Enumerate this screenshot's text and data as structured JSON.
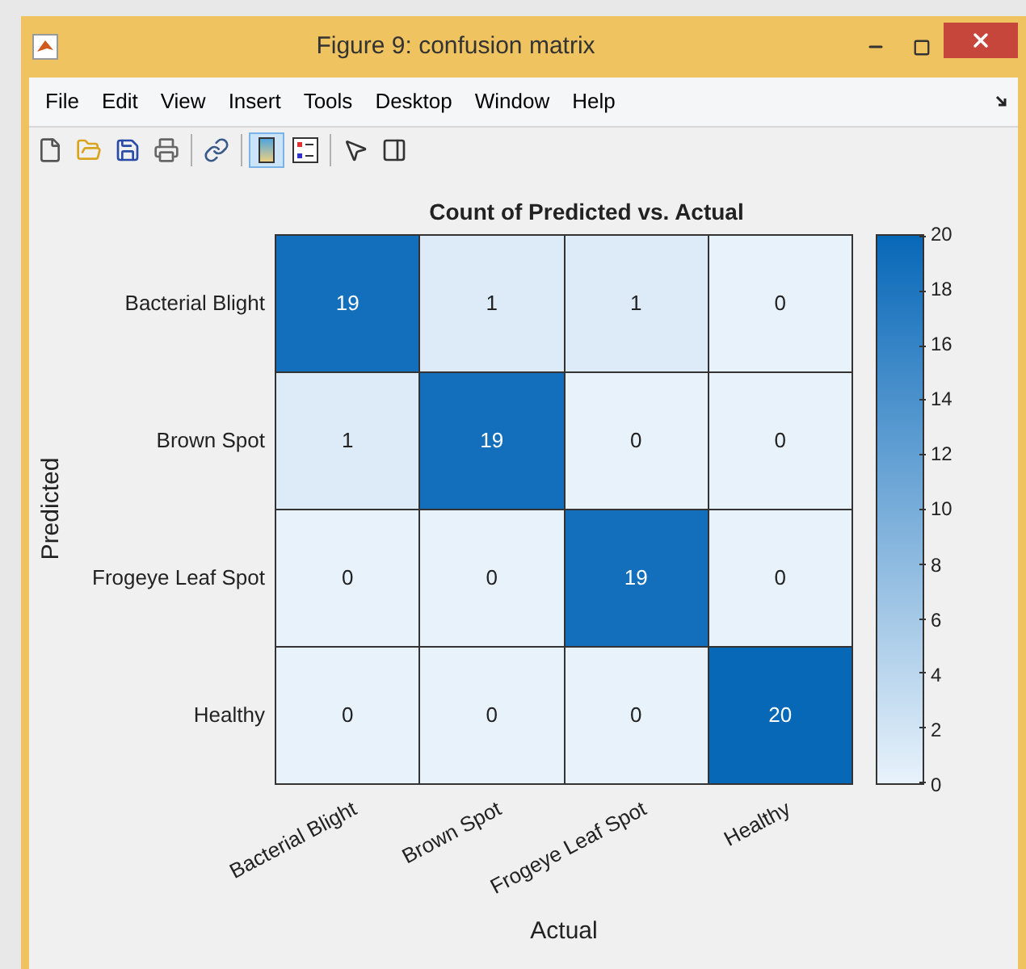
{
  "window": {
    "title": "Figure 9: confusion matrix"
  },
  "menu": [
    "File",
    "Edit",
    "View",
    "Insert",
    "Tools",
    "Desktop",
    "Window",
    "Help"
  ],
  "toolbar": [
    {
      "kind": "new",
      "selected": false
    },
    {
      "kind": "open",
      "selected": false
    },
    {
      "kind": "save",
      "selected": false
    },
    {
      "kind": "print",
      "selected": false
    },
    {
      "kind": "link",
      "selected": false
    },
    {
      "kind": "colorbar",
      "selected": true
    },
    {
      "kind": "legend",
      "selected": false
    },
    {
      "kind": "pointer",
      "selected": false
    },
    {
      "kind": "panel",
      "selected": false
    }
  ],
  "plot": {
    "title": "Count of Predicted vs. Actual",
    "ylabel": "Predicted",
    "xlabel": "Actual",
    "row_labels": [
      "Bacterial Blight",
      "Brown Spot",
      "Frogeye Leaf Spot",
      "Healthy"
    ],
    "column_labels": [
      "Bacterial Blight",
      "Brown Spot",
      "Frogeye Leaf Spot",
      "Healthy"
    ],
    "rows": [
      [
        "19",
        "1",
        "1",
        "0"
      ],
      [
        "1",
        "19",
        "0",
        "0"
      ],
      [
        "0",
        "0",
        "19",
        "0"
      ],
      [
        "0",
        "0",
        "0",
        "20"
      ]
    ],
    "colorbar_ticks": [
      "20",
      "18",
      "16",
      "14",
      "12",
      "10",
      "8",
      "6",
      "4",
      "2",
      "0"
    ]
  }
}
